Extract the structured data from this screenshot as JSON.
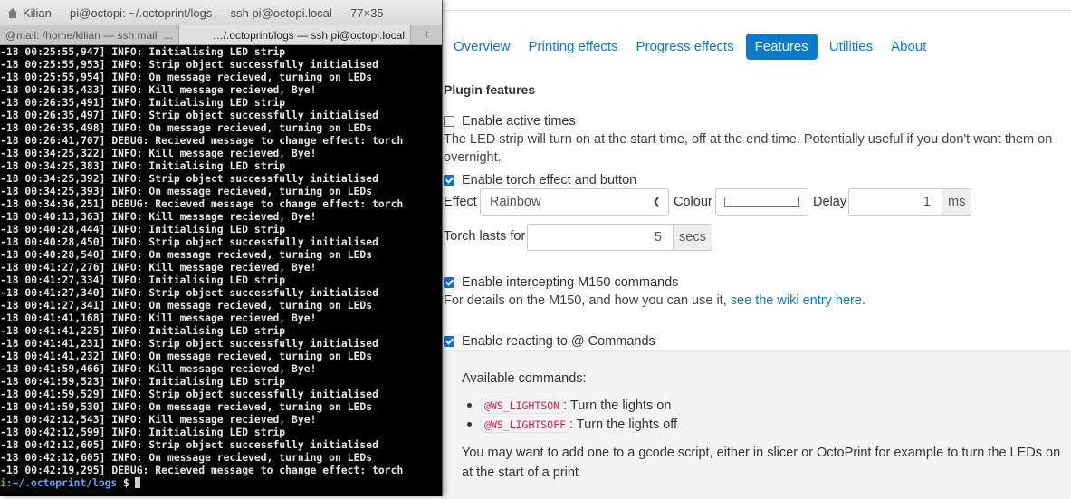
{
  "terminal": {
    "title": "Kilian — pi@octopi: ~/.octoprint/logs — ssh pi@octopi.local — 77×35",
    "tabs": [
      {
        "label": "@mail: /home/kilian — ssh mail",
        "dots": "..."
      },
      {
        "label": "…/.octoprint/logs — ssh pi@octopi.local"
      }
    ],
    "new_tab": "+",
    "lines": [
      "-18 00:25:55,947] INFO: Initialising LED strip",
      "-18 00:25:55,953] INFO: Strip object successfully initialised",
      "-18 00:25:55,954] INFO: On message recieved, turning on LEDs",
      "-18 00:26:35,433] INFO: Kill message recieved, Bye!",
      "-18 00:26:35,491] INFO: Initialising LED strip",
      "-18 00:26:35,497] INFO: Strip object successfully initialised",
      "-18 00:26:35,498] INFO: On message recieved, turning on LEDs",
      "-18 00:26:41,707] DEBUG: Recieved message to change effect: torch",
      "-18 00:34:25,322] INFO: Kill message recieved, Bye!",
      "-18 00:34:25,383] INFO: Initialising LED strip",
      "-18 00:34:25,392] INFO: Strip object successfully initialised",
      "-18 00:34:25,393] INFO: On message recieved, turning on LEDs",
      "-18 00:34:36,251] DEBUG: Recieved message to change effect: torch",
      "-18 00:40:13,363] INFO: Kill message recieved, Bye!",
      "-18 00:40:28,444] INFO: Initialising LED strip",
      "-18 00:40:28,450] INFO: Strip object successfully initialised",
      "-18 00:40:28,540] INFO: On message recieved, turning on LEDs",
      "-18 00:41:27,276] INFO: Kill message recieved, Bye!",
      "-18 00:41:27,334] INFO: Initialising LED strip",
      "-18 00:41:27,340] INFO: Strip object successfully initialised",
      "-18 00:41:27,341] INFO: On message recieved, turning on LEDs",
      "-18 00:41:41,168] INFO: Kill message recieved, Bye!",
      "-18 00:41:41,225] INFO: Initialising LED strip",
      "-18 00:41:41,231] INFO: Strip object successfully initialised",
      "-18 00:41:41,232] INFO: On message recieved, turning on LEDs",
      "-18 00:41:59,466] INFO: Kill message recieved, Bye!",
      "-18 00:41:59,523] INFO: Initialising LED strip",
      "-18 00:41:59,529] INFO: Strip object successfully initialised",
      "-18 00:41:59,530] INFO: On message recieved, turning on LEDs",
      "-18 00:42:12,543] INFO: Kill message recieved, Bye!",
      "-18 00:42:12,599] INFO: Initialising LED strip",
      "-18 00:42:12,605] INFO: Strip object successfully initialised",
      "-18 00:42:12,605] INFO: On message recieved, turning on LEDs",
      "-18 00:42:19,295] DEBUG: Recieved message to change effect: torch"
    ],
    "prompt": {
      "host": "i",
      "path": ":~/.octoprint/logs",
      "symbol": " $"
    }
  },
  "settings": {
    "tabs": [
      {
        "label": "Overview",
        "active": false
      },
      {
        "label": "Printing effects",
        "active": false
      },
      {
        "label": "Progress effects",
        "active": false
      },
      {
        "label": "Features",
        "active": true
      },
      {
        "label": "Utilities",
        "active": false
      },
      {
        "label": "About",
        "active": false
      }
    ],
    "section_title": "Plugin features",
    "active_times": {
      "label": "Enable active times",
      "checked": false,
      "help": "The LED strip will turn on at the start time, off at the end time. Potentially useful if you don't want them on overnight."
    },
    "torch": {
      "label": "Enable torch effect and button",
      "checked": true,
      "effect_label": "Effect",
      "effect_value": "Rainbow",
      "colour_label": "Colour",
      "colour_value": "#ffffff",
      "delay_label": "Delay",
      "delay_value": "1",
      "delay_unit": "ms",
      "lasts_label": "Torch lasts for",
      "lasts_value": "5",
      "lasts_unit": "secs"
    },
    "m150": {
      "label": "Enable intercepting M150 commands",
      "checked": true,
      "help_prefix": "For details on the M150, and how you can use it, ",
      "help_link": "see the wiki entry here."
    },
    "at_commands": {
      "label": "Enable reacting to @ Commands",
      "checked": true,
      "available": "Available commands:",
      "commands": [
        {
          "code": "@WS_LIGHTSON",
          "desc": ": Turn the lights on"
        },
        {
          "code": "@WS_LIGHTSOFF",
          "desc": ": Turn the lights off"
        }
      ],
      "note": "You may want to add one to a gcode script, either in slicer or OctoPrint for example to turn the LEDs on at the start of a print"
    }
  }
}
